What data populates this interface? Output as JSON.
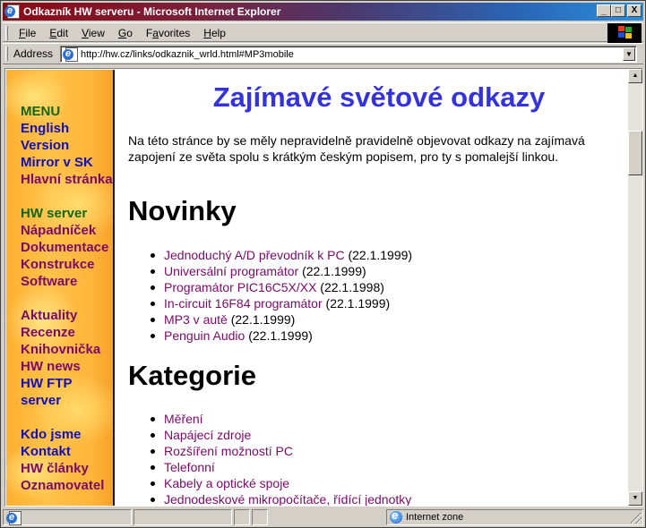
{
  "window": {
    "title": "Odkazník HW serveru - Microsoft Internet Explorer",
    "controls": {
      "minimize": "_",
      "maximize": "□",
      "close": "X"
    }
  },
  "menubar": {
    "items": [
      {
        "label": "File",
        "accel": "F",
        "rest": "ile"
      },
      {
        "label": "Edit",
        "accel": "E",
        "rest": "dit"
      },
      {
        "label": "View",
        "accel": "V",
        "rest": "iew"
      },
      {
        "label": "Go",
        "accel": "G",
        "rest": "o"
      },
      {
        "label": "Favorites",
        "pre": "F",
        "accel": "a",
        "rest": "vorites"
      },
      {
        "label": "Help",
        "accel": "H",
        "rest": "elp"
      }
    ]
  },
  "addressbar": {
    "label": "Address",
    "url": "http://hw.cz/links/odkaznik_wrld.html#MP3mobile"
  },
  "sidebar": {
    "menu_heading": "MENU",
    "group1": [
      "English",
      "Version",
      "Mirror v SK",
      "Hlavní stránka"
    ],
    "group2_heading": "HW server",
    "group2": [
      "Nápadníček",
      "Dokumentace",
      "Konstrukce",
      "Software"
    ],
    "group3": [
      "Aktuality",
      "Recenze",
      "Knihovnička",
      "HW news"
    ],
    "group3_blue": [
      "HW FTP",
      "server"
    ],
    "group4_blue": [
      "Kdo jsme",
      "Kontakt"
    ],
    "group4": [
      "HW články",
      "Oznamovatel"
    ]
  },
  "main": {
    "title": "Zajímavé světové odkazy",
    "intro": "Na této stránce by se měly nepravidelně pravidelně objevovat odkazy na zajímavá zapojení ze světa spolu s krátkým českým popisem, pro ty s pomalejší linkou.",
    "novinky": {
      "heading": "Novinky",
      "items": [
        {
          "link": "Jednoduchý A/D převodník k PC",
          "date": "(22.1.1999)"
        },
        {
          "link": "Universální programátor",
          "date": "(22.1.1999)"
        },
        {
          "link": "Programátor PIC16C5X/XX",
          "date": "(22.1.1998)"
        },
        {
          "link": "In-circuit 16F84 programátor",
          "date": "(22.1.1999)"
        },
        {
          "link": "MP3 v autě",
          "date": "(22.1.1999)"
        },
        {
          "link": "Penguin Audio",
          "date": "(22.1.1999)"
        }
      ]
    },
    "kategorie": {
      "heading": "Kategorie",
      "items": [
        "Měření",
        "Napájecí zdroje",
        "Rozšíření možností PC",
        "Telefonní",
        "Kabely a optické spoje",
        "Jednodeskové mikropočítače, řídící jednotky"
      ]
    }
  },
  "scrollbar": {
    "position_fraction": 0.15
  },
  "statusbar": {
    "status_text": "",
    "zone": "Internet zone"
  },
  "colors": {
    "title_blue": "#3333dd",
    "link_visited": "#7a0a6a",
    "nav_green": "#116611",
    "nav_blue": "#1010b8",
    "sidebar_orange": "#ffb030"
  }
}
